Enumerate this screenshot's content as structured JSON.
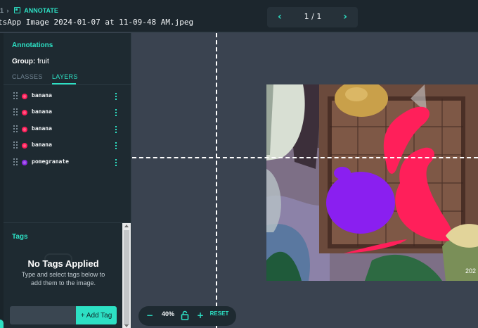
{
  "header": {
    "breadcrumb_num": "1",
    "breadcrumb_sep": "›",
    "section_label": "ANNOTATE",
    "filename": "tsApp Image 2024-01-07 at 11-09-48 AM.jpeg",
    "pager": {
      "prev_icon": "chevron-left-icon",
      "next_icon": "chevron-right-icon",
      "count": "1 / 1"
    }
  },
  "sidebar": {
    "title": "Annotations",
    "group_label": "Group:",
    "group_value": "fruit",
    "tabs": [
      {
        "label": "CLASSES",
        "active": false
      },
      {
        "label": "LAYERS",
        "active": true
      }
    ],
    "layers": [
      {
        "name": "banana",
        "color": "#ff1f5a"
      },
      {
        "name": "banana",
        "color": "#ff1f5a"
      },
      {
        "name": "banana",
        "color": "#ff1f5a"
      },
      {
        "name": "banana",
        "color": "#ff1f5a"
      },
      {
        "name": "pomegranate",
        "color": "#8a2be2"
      }
    ],
    "tags": {
      "title": "Tags",
      "empty_title": "No Tags Applied",
      "empty_desc": "Type and select tags below to add them to the image.",
      "input_value": "",
      "input_placeholder": "",
      "add_label": "+ Add Tag"
    }
  },
  "canvas": {
    "image_corner_text": "202",
    "zoom": {
      "out_label": "−",
      "level": "40%",
      "lock_icon": "lock-icon",
      "in_label": "+",
      "reset_label": "RESET"
    }
  },
  "colors": {
    "accent": "#2de0c4",
    "banana": "#ff1f5a",
    "pomegranate": "#8a2be2"
  }
}
